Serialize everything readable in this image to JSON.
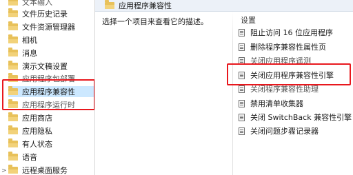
{
  "tree": {
    "items": [
      {
        "label": "文本输入",
        "selected": false
      },
      {
        "label": "文件历史记录",
        "selected": false
      },
      {
        "label": "文件资源管理器",
        "selected": false
      },
      {
        "label": "相机",
        "selected": false
      },
      {
        "label": "消息",
        "selected": false
      },
      {
        "label": "演示文稿设置",
        "selected": false
      },
      {
        "label": "应用程序包部署",
        "selected": false
      },
      {
        "label": "应用程序兼容性",
        "selected": true
      },
      {
        "label": "应用程序运行时",
        "selected": false
      },
      {
        "label": "应用商店",
        "selected": false
      },
      {
        "label": "应用隐私",
        "selected": false
      },
      {
        "label": "有人状态",
        "selected": false
      },
      {
        "label": "语音",
        "selected": false
      },
      {
        "label": "远程桌面服务",
        "selected": false
      }
    ],
    "expander": ">"
  },
  "header": {
    "title": "应用程序兼容性"
  },
  "description": "选择一个项目来查看它的描述。",
  "settings": {
    "column_header": "设置",
    "items": [
      {
        "label": "阻止访问 16 位应用程序"
      },
      {
        "label": "删除程序兼容性属性页"
      },
      {
        "label": "关闭应用程序遥测"
      },
      {
        "label": "关闭应用程序兼容性引擎"
      },
      {
        "label": "关闭程序兼容性助理"
      },
      {
        "label": "禁用清单收集器"
      },
      {
        "label": "关闭 SwitchBack 兼容性引擎"
      },
      {
        "label": "关闭问题步骤记录器"
      }
    ]
  },
  "colors": {
    "highlight_box": "#e8171d",
    "selection": "#cce8ff",
    "folder": "#e8c15a",
    "header_band": "#ecf1f8"
  }
}
